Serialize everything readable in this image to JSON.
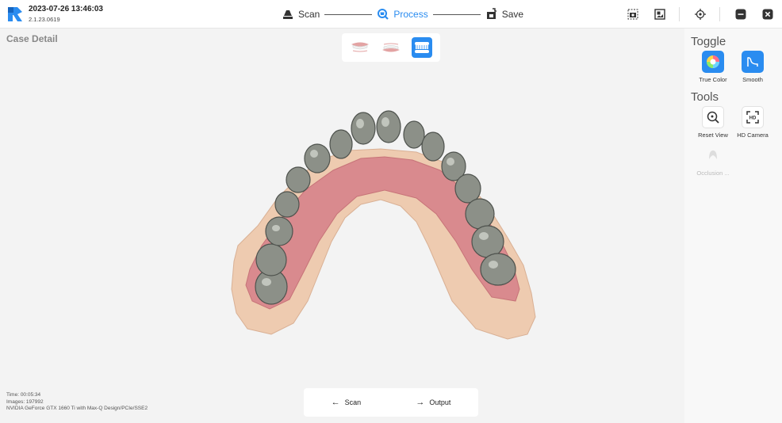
{
  "header": {
    "timestamp": "2023-07-26 13:46:03",
    "version": "2.1.23.0619",
    "steps": [
      {
        "label": "Scan",
        "icon": "scan-icon",
        "active": false
      },
      {
        "label": "Process",
        "icon": "process-icon",
        "active": true
      },
      {
        "label": "Save",
        "icon": "save-icon",
        "active": false
      }
    ],
    "toolbar_icons": [
      "screenshot-icon",
      "image-gallery-icon",
      "locate-icon",
      "minimize-icon",
      "close-icon"
    ]
  },
  "case": {
    "title": "Case Detail"
  },
  "view_switch": {
    "options": [
      "upper-jaw-icon",
      "lower-jaw-icon",
      "both-jaws-icon"
    ],
    "active": "both-jaws-icon"
  },
  "right_panel": {
    "toggle_heading": "Toggle",
    "toggle_items": [
      {
        "label": "True Color",
        "icon": "true-color-icon"
      },
      {
        "label": "Smooth",
        "icon": "smooth-icon"
      }
    ],
    "tools_heading": "Tools",
    "tools_items": [
      {
        "label": "Reset View",
        "icon": "reset-view-icon"
      },
      {
        "label": "HD Camera",
        "icon": "hd-camera-icon"
      },
      {
        "label": "Occlusion ...",
        "icon": "occlusion-icon",
        "disabled": true
      }
    ]
  },
  "info": {
    "time": "Time: 00:05:34",
    "images": "Images: 197992",
    "gpu": "NVIDIA GeForce GTX 1660 Ti with Max-Q Design/PCIe/SSE2"
  },
  "bottom_nav": {
    "back_label": "Scan",
    "next_label": "Output"
  },
  "colors": {
    "accent": "#2a8cf0",
    "gum": "#d98a8e",
    "plaster": "#eecbb0",
    "tooth_metal": "#8c9088"
  }
}
